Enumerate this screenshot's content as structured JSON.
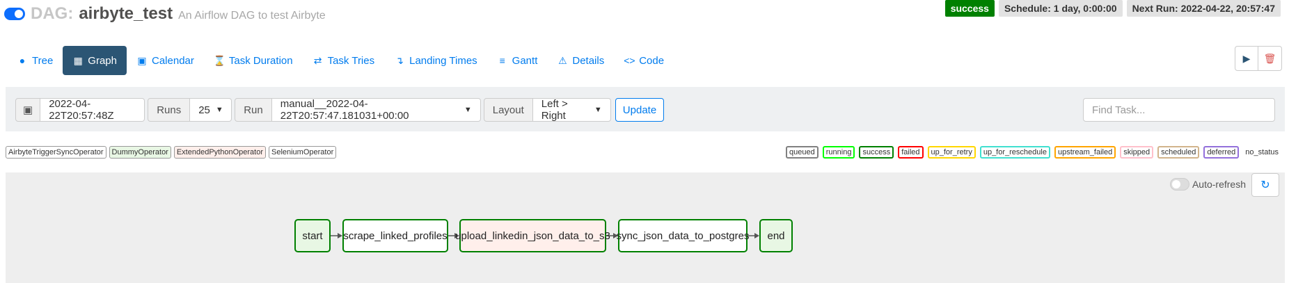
{
  "header": {
    "dag_prefix": "DAG:",
    "dag_name": "airbyte_test",
    "description": "An Airflow DAG to test Airbyte",
    "status": "success",
    "schedule": "Schedule: 1 day, 0:00:00",
    "next_run": "Next Run: 2022-04-22, 20:57:47"
  },
  "tabs": [
    {
      "label": "Tree",
      "icon": "tree-icon"
    },
    {
      "label": "Graph",
      "icon": "graph-icon"
    },
    {
      "label": "Calendar",
      "icon": "calendar-icon"
    },
    {
      "label": "Task Duration",
      "icon": "hourglass-icon"
    },
    {
      "label": "Task Tries",
      "icon": "retry-icon"
    },
    {
      "label": "Landing Times",
      "icon": "landing-icon"
    },
    {
      "label": "Gantt",
      "icon": "gantt-icon"
    },
    {
      "label": "Details",
      "icon": "warning-icon"
    },
    {
      "label": "Code",
      "icon": "code-icon"
    }
  ],
  "filters": {
    "date": "2022-04-22T20:57:48Z",
    "runs_label": "Runs",
    "runs_value": "25",
    "run_label": "Run",
    "run_value": "manual__2022-04-22T20:57:47.181031+00:00",
    "layout_label": "Layout",
    "layout_value": "Left > Right",
    "update_label": "Update",
    "find_placeholder": "Find Task..."
  },
  "operators": [
    {
      "name": "AirbyteTriggerSyncOperator",
      "color": "#ffffff"
    },
    {
      "name": "DummyOperator",
      "color": "#e8f7e4"
    },
    {
      "name": "ExtendedPythonOperator",
      "color": "#ffefeb"
    },
    {
      "name": "SeleniumOperator",
      "color": "#ffffff"
    }
  ],
  "statuses": [
    {
      "name": "queued",
      "color": "#808080"
    },
    {
      "name": "running",
      "color": "#00ff00"
    },
    {
      "name": "success",
      "color": "#008000"
    },
    {
      "name": "failed",
      "color": "#ff0000"
    },
    {
      "name": "up_for_retry",
      "color": "#ffd700"
    },
    {
      "name": "up_for_reschedule",
      "color": "#40e0d0"
    },
    {
      "name": "upstream_failed",
      "color": "#ffa500"
    },
    {
      "name": "skipped",
      "color": "#ffc0cb"
    },
    {
      "name": "scheduled",
      "color": "#d2b48c"
    },
    {
      "name": "deferred",
      "color": "#9370db"
    },
    {
      "name": "no_status",
      "color": ""
    }
  ],
  "graph": {
    "auto_refresh_label": "Auto-refresh",
    "nodes": [
      {
        "label": "start",
        "fill": "#e8f7e4"
      },
      {
        "label": "scrape_linked_profiles",
        "fill": "#ffffff"
      },
      {
        "label": "upload_linkedin_json_data_to_s3",
        "fill": "#ffefeb"
      },
      {
        "label": "sync_json_data_to_postgres",
        "fill": "#ffffff"
      },
      {
        "label": "end",
        "fill": "#e8f7e4"
      }
    ]
  }
}
